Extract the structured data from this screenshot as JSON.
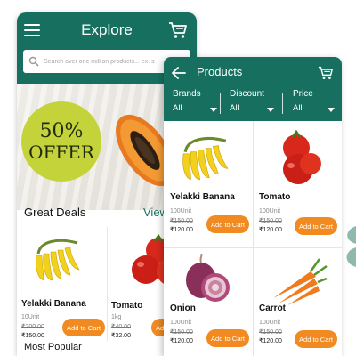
{
  "explore": {
    "title": "Explore",
    "search_placeholder": "Search over one million products... ex. s",
    "banner": {
      "offer_line1": "50%",
      "offer_line2": "OFFER"
    },
    "section_title": "Great Deals",
    "view_link": "View",
    "products": [
      {
        "name": "Yelakki Banana",
        "unit": "10Unit",
        "old_price": "₹200.00",
        "new_price": "₹150.00",
        "button": "Add to Cart"
      },
      {
        "name": "Tomato",
        "unit": "1kg",
        "old_price": "₹40.00",
        "new_price": "₹32.00",
        "button": "Add to Cart"
      }
    ],
    "next_section": "Most Popular"
  },
  "products_screen": {
    "title": "Products",
    "filters": [
      {
        "label": "Brands",
        "value": "All"
      },
      {
        "label": "Discount",
        "value": "All"
      },
      {
        "label": "Price",
        "value": "All"
      }
    ],
    "products": [
      {
        "name": "Yelakki Banana",
        "unit": "100Unit",
        "old_price": "₹150.00",
        "new_price": "₹120.00",
        "button": "Add to Cart"
      },
      {
        "name": "Tomato",
        "unit": "100Unit",
        "old_price": "₹150.00",
        "new_price": "₹120.00",
        "button": "Add to Cart"
      },
      {
        "name": "Onion",
        "unit": "100Unit",
        "old_price": "₹150.00",
        "new_price": "₹120.00",
        "button": "Add to Cart"
      },
      {
        "name": "Carrot",
        "unit": "100Unit",
        "old_price": "₹150.00",
        "new_price": "₹120.00",
        "button": "Add to Cart"
      }
    ]
  },
  "colors": {
    "header": "#17705f",
    "accent_button": "#f08a21",
    "offer_badge": "#c5d33a"
  },
  "icons": [
    "menu-icon",
    "cart-icon",
    "search-icon",
    "back-arrow-icon",
    "dropdown-caret-icon"
  ]
}
